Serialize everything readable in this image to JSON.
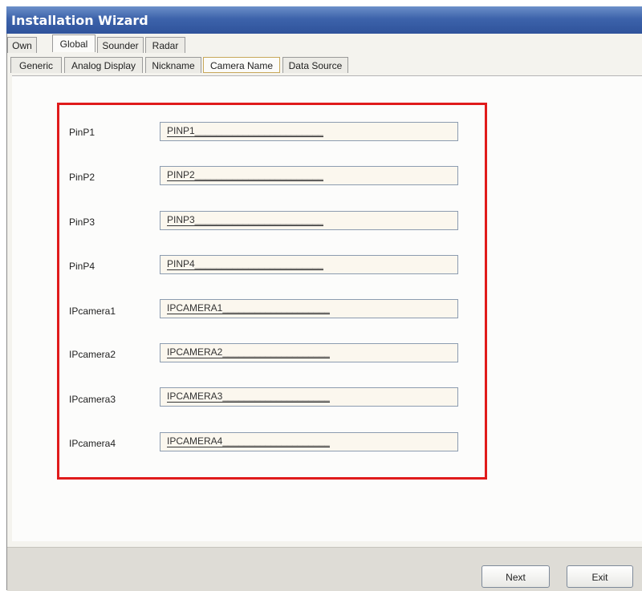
{
  "window": {
    "title": "Installation Wizard"
  },
  "tabs_top": [
    "Own",
    "Global",
    "Sounder",
    "Radar"
  ],
  "tabs_top_selected": "Global",
  "tabs_sub": [
    "Generic",
    "Analog Display",
    "Nickname",
    "Camera Name",
    "Data Source"
  ],
  "tabs_sub_selected": "Camera Name",
  "fields": [
    {
      "label": "PinP1",
      "value": "PINP1________________________"
    },
    {
      "label": "PinP2",
      "value": "PINP2________________________"
    },
    {
      "label": "PinP3",
      "value": "PINP3________________________"
    },
    {
      "label": "PinP4",
      "value": "PINP4________________________"
    },
    {
      "label": "IPcamera1",
      "value": "IPCAMERA1____________________"
    },
    {
      "label": "IPcamera2",
      "value": "IPCAMERA2____________________"
    },
    {
      "label": "IPcamera3",
      "value": "IPCAMERA3____________________"
    },
    {
      "label": "IPcamera4",
      "value": "IPCAMERA4____________________"
    }
  ],
  "buttons": {
    "next": "Next",
    "exit": "Exit"
  },
  "colors": {
    "titlebar": "#3d63ab",
    "highlight_box": "#e01b1b",
    "watermark_orange": "#f5d08f",
    "watermark_blue": "#c9c9d8"
  }
}
